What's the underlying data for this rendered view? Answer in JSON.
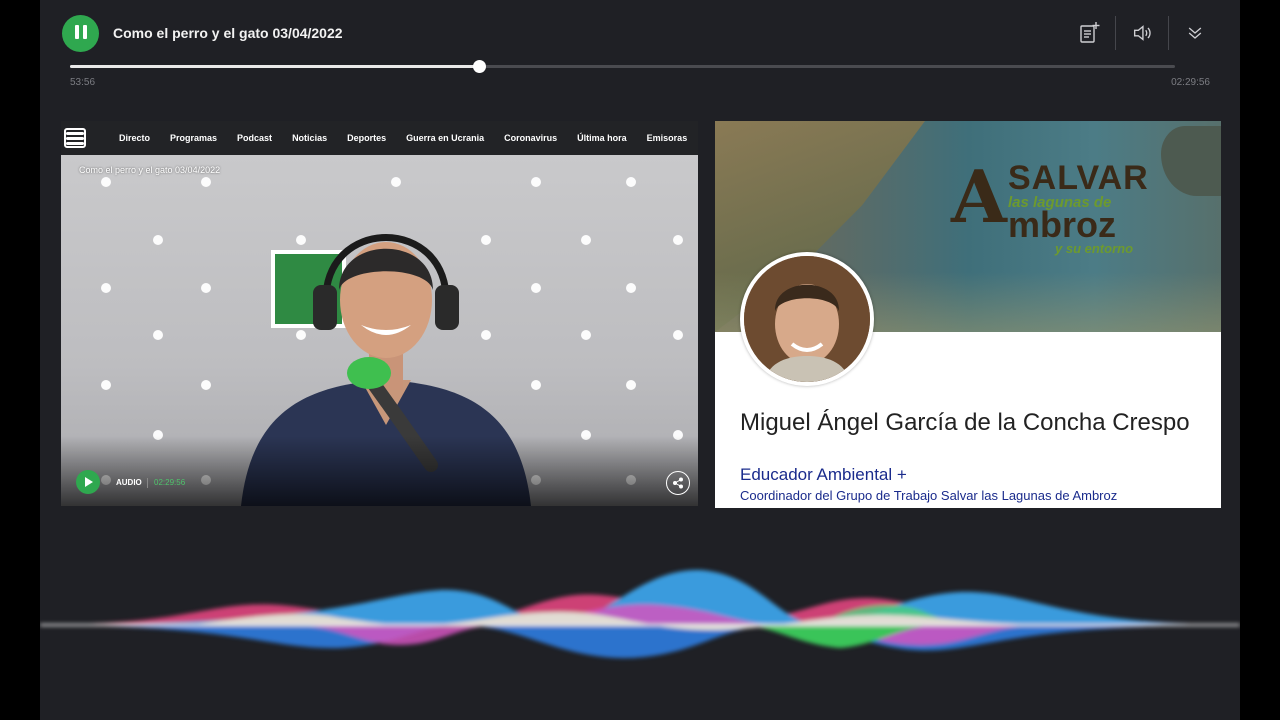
{
  "player": {
    "title": "Como el perro y el gato 03/04/2022",
    "elapsed": "53:56",
    "total": "02:29:56",
    "progress_fraction": 0.37,
    "accent_color": "#2fa84f",
    "icons": [
      "pause-icon",
      "add-to-playlist-icon",
      "volume-icon",
      "chevron-double-down-icon"
    ]
  },
  "website": {
    "nav": [
      "Directo",
      "Programas",
      "Podcast",
      "Noticias",
      "Deportes",
      "Guerra en Ucrania",
      "Coronavirus",
      "Última hora",
      "Emisoras"
    ],
    "video_title": "Como el perro y el gato 03/04/2022",
    "audio_label": "AUDIO",
    "audio_duration": "02:29:56"
  },
  "profile": {
    "banner_logo": {
      "big_letter": "A",
      "line1": "SALVAR",
      "line2": "las lagunas de",
      "line3": "mbroz",
      "line4": "y su entorno"
    },
    "name": "Miguel Ángel García de la Concha Crespo",
    "role": "Educador Ambiental +",
    "description": "Coordinador del Grupo de Trabajo Salvar las Lagunas de Ambroz"
  }
}
